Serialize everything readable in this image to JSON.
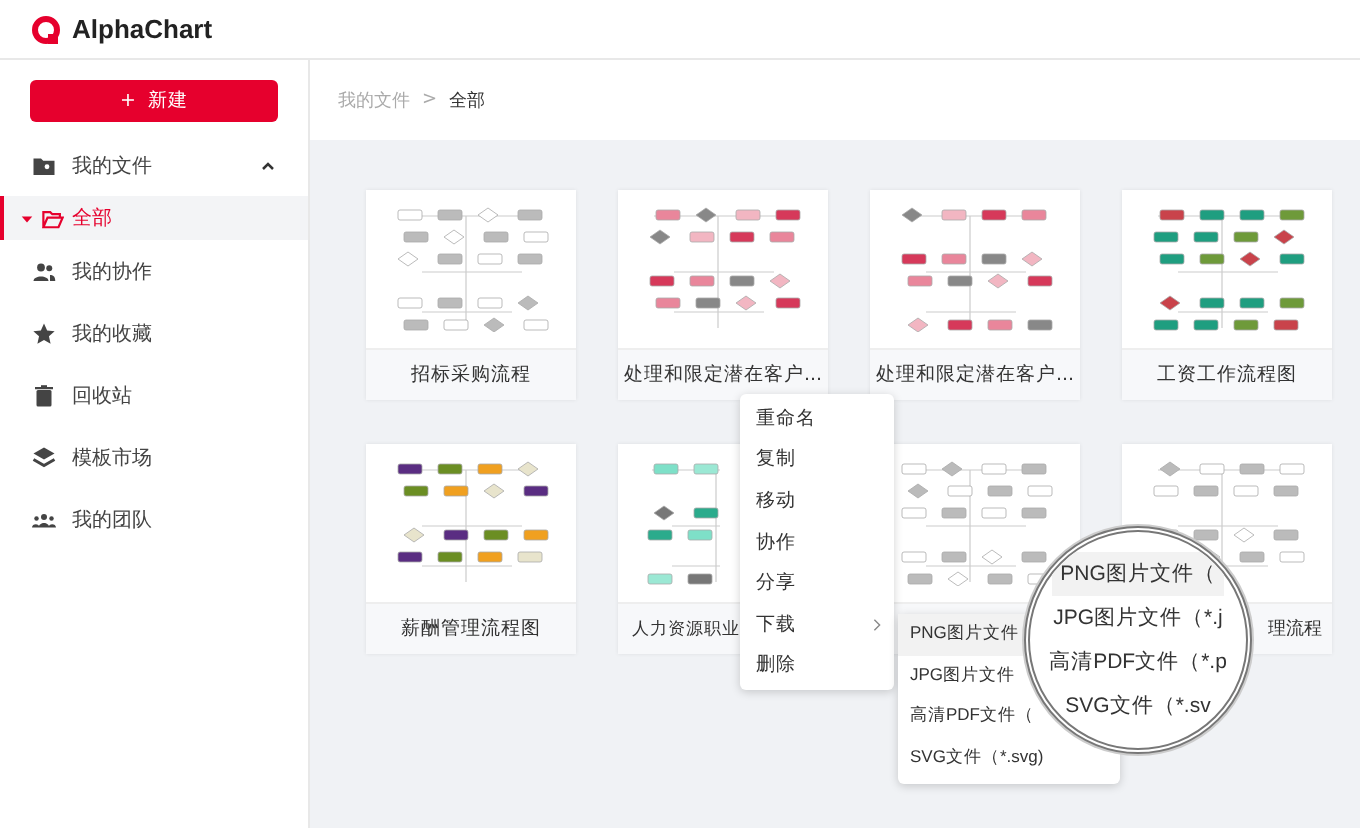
{
  "app": {
    "name": "AlphaChart"
  },
  "sidebar": {
    "new_button": "+  新建",
    "items": [
      {
        "label": "我的文件",
        "expanded": true,
        "children": [
          {
            "label": "全部",
            "selected": true
          }
        ]
      },
      {
        "label": "我的协作",
        "selected": false
      },
      {
        "label": "我的收藏",
        "selected": false
      },
      {
        "label": "回收站",
        "selected": false
      },
      {
        "label": "模板市场",
        "selected": false
      },
      {
        "label": "我的团队",
        "selected": false
      }
    ]
  },
  "breadcrumb": [
    "我的文件",
    ">",
    "全部"
  ],
  "files": [
    {
      "kind": "file",
      "name": "招标采购流程"
    },
    {
      "kind": "file",
      "name": "处理和限定潜在客户..."
    },
    {
      "kind": "file",
      "name": "处理和限定潜在客户..."
    },
    {
      "kind": "file",
      "name": "工资工作流程图"
    },
    {
      "kind": "file",
      "name": "薪酬管理流程图"
    },
    {
      "kind": "file",
      "name": "人力资源职业"
    },
    {
      "kind": "file"
    },
    {
      "kind": "file",
      "name": "理流程"
    }
  ],
  "context_menu": [
    {
      "label": "重命名",
      "submenu": false
    },
    {
      "label": "复制",
      "submenu": false
    },
    {
      "label": "移动",
      "submenu": false
    },
    {
      "label": "协作",
      "submenu": false
    },
    {
      "label": "分享",
      "submenu": false
    },
    {
      "label": "下载",
      "submenu": true
    },
    {
      "label": "删除",
      "submenu": false
    }
  ],
  "download_submenu": [
    {
      "label": "PNG图片文件",
      "selected": true
    },
    {
      "label": "JPG图片文件",
      "selected": false
    },
    {
      "label": "高清PDF文件（",
      "selected": false
    },
    {
      "label": "SVG文件（*.svg)",
      "selected": false
    }
  ],
  "magnifier": [
    {
      "label": "PNG图片文件（",
      "selected": true
    },
    {
      "label": "JPG图片文件（*.j",
      "selected": false
    },
    {
      "label": "高清PDF文件（*.p",
      "selected": false
    },
    {
      "label": "SVG文件（*.sv",
      "selected": false
    }
  ]
}
